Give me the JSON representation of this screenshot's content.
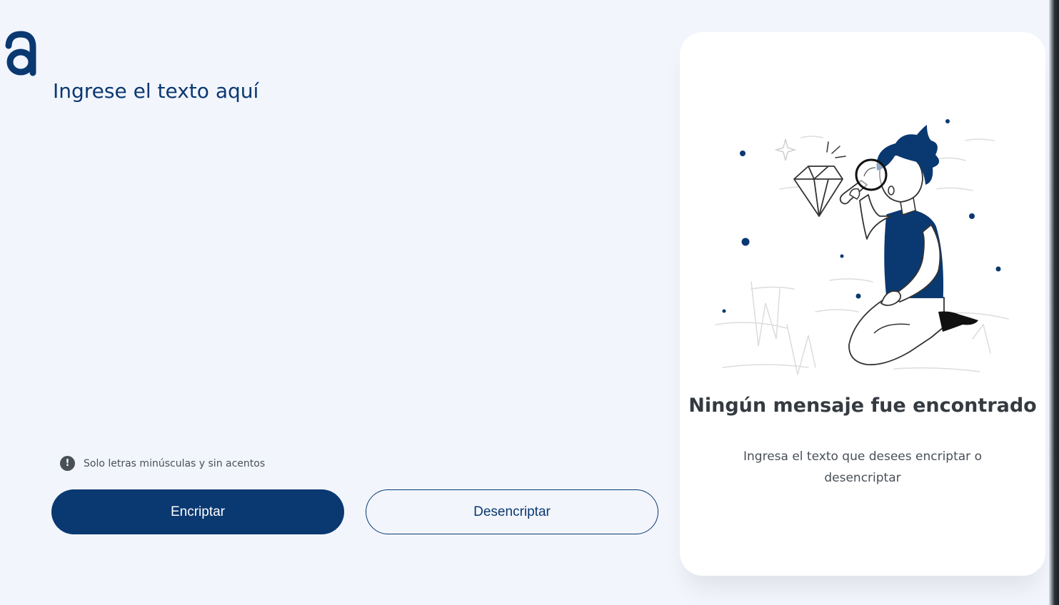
{
  "brand": {
    "logo_letter": "a",
    "accent_color": "#0a3871"
  },
  "input": {
    "placeholder": "Ingrese el texto aquí",
    "value": ""
  },
  "hint": {
    "icon": "exclamation-circle-icon",
    "text": "Solo letras minúsculas y sin acentos"
  },
  "buttons": {
    "encrypt_label": "Encriptar",
    "decrypt_label": "Desencriptar"
  },
  "output_panel": {
    "illustration": "person-with-magnifier-and-diamond",
    "title": "Ningún mensaje fue encontrado",
    "subtitle": "Ingresa el texto que desees encriptar o desencriptar"
  }
}
